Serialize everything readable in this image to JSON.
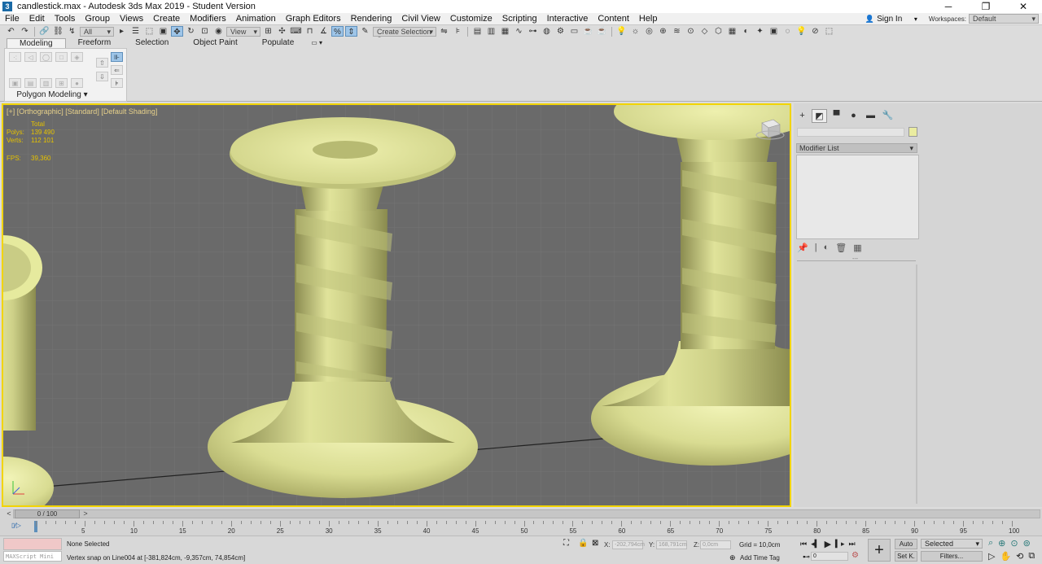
{
  "window": {
    "app_icon": "3",
    "title": "candlestick.max - Autodesk 3ds Max 2019 - Student Version",
    "buttons": [
      "─",
      "❐",
      "✕"
    ]
  },
  "menubar": {
    "items": [
      "File",
      "Edit",
      "Tools",
      "Group",
      "Views",
      "Create",
      "Modifiers",
      "Animation",
      "Graph Editors",
      "Rendering",
      "Civil View",
      "Customize",
      "Scripting",
      "Interactive",
      "Content",
      "Help"
    ],
    "sign_in": "Sign In",
    "workspaces_label": "Workspaces:",
    "workspaces_value": "Default"
  },
  "toolbar": {
    "filter_value": "All",
    "view_value": "View",
    "selection_set": "Create Selection Set"
  },
  "ribbon": {
    "tabs": [
      "Modeling",
      "Freeform",
      "Selection",
      "Object Paint",
      "Populate"
    ],
    "panel_label": "Polygon Modeling ▾"
  },
  "viewport": {
    "label": "[+] [Orthographic] [Standard] [Default Shading]",
    "stats": {
      "total": "Total",
      "polys_label": "Polys:",
      "polys_value": "139 490",
      "verts_label": "Verts:",
      "verts_value": "112 101",
      "fps_label": "FPS:",
      "fps_value": "39,360"
    },
    "object_color": "#e6ea9e"
  },
  "command_panel": {
    "tabs": [
      "+",
      "◩",
      "▀",
      "●",
      "▬",
      "🔧"
    ],
    "modifier_list": "Modifier List",
    "stack_buttons": [
      "📌",
      "|",
      "◐",
      "🗑",
      "▦"
    ],
    "rollout": "---"
  },
  "timeslider": {
    "frame_label": "0 / 100",
    "prev": "<",
    "next": ">"
  },
  "trackbar": {
    "ticks": [
      "5",
      "10",
      "15",
      "20",
      "25",
      "30",
      "35",
      "40",
      "45",
      "50",
      "55",
      "60",
      "65",
      "70",
      "75",
      "80",
      "85",
      "90",
      "95",
      "100"
    ]
  },
  "statusbar": {
    "maxscript_placeholder": "MAXScript Mini",
    "selection": "None Selected",
    "prompt": "Vertex snap on Line004 at [-381,824cm, -9,357cm, 74,854cm]",
    "x_label": "X:",
    "x_value": "-202,794cm",
    "y_label": "Y:",
    "y_value": "168,791cm",
    "z_label": "Z:",
    "z_value": "0,0cm",
    "grid": "Grid = 10,0cm",
    "add_time_tag": "Add Time Tag",
    "auto_key": "Auto",
    "set_key": "Set K.",
    "selected": "Selected",
    "filters": "Filters...",
    "frame": "0"
  }
}
